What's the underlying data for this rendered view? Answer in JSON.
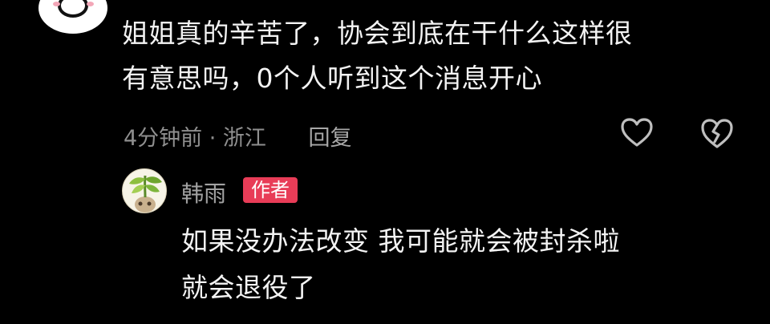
{
  "comment": {
    "avatar": "smiley-face-avatar",
    "text_line_1": "姐姐真的辛苦了，协会到底在干什么这样很",
    "text_line_2": "有意思吗，0个人听到这个消息开心",
    "time_location": "4分钟前 · 浙江",
    "reply_label": "回复",
    "like_icon": "heart-outline-icon",
    "dislike_icon": "broken-heart-icon"
  },
  "reply": {
    "avatar": "plant-sprout-avatar",
    "author_name": "韩雨",
    "author_badge": "作者",
    "text_line_1": "如果没办法改变 我可能就会被封杀啦",
    "text_line_2": "就会退役了"
  },
  "colors": {
    "background": "#000000",
    "primary_text": "#f3f3f3",
    "secondary_text": "#8f8f8f",
    "badge": "#e83c57"
  }
}
